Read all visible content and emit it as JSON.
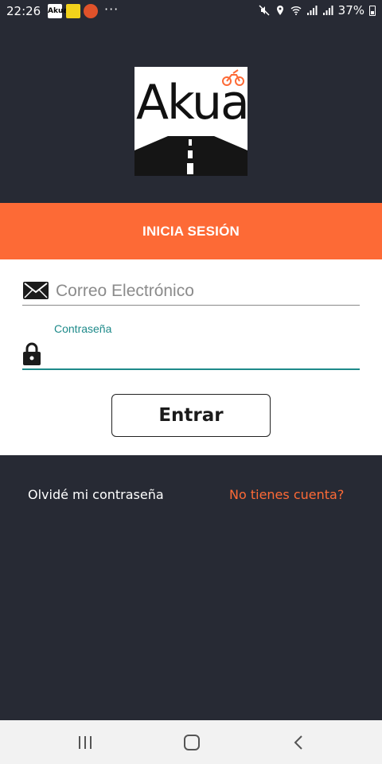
{
  "status_bar": {
    "time": "22:26",
    "notif_app_label": "Akua",
    "more": "···",
    "battery": "37%"
  },
  "brand": {
    "logo_text": "Akua"
  },
  "banner": {
    "title": "INICIA SESIÓN",
    "color": "#fd6a36"
  },
  "form": {
    "email": {
      "placeholder": "Correo Electrónico",
      "value": "",
      "icon": "envelope-icon"
    },
    "password": {
      "label": "Contraseña",
      "value": "",
      "icon": "lock-icon",
      "accent": "#1e8a8a"
    },
    "submit_label": "Entrar"
  },
  "links": {
    "forgot": "Olvidé mi contraseña",
    "signup": "No tienes cuenta?"
  },
  "nav_bar": {
    "recents_icon": "recents-icon",
    "home_icon": "home-icon",
    "back_icon": "back-icon"
  }
}
